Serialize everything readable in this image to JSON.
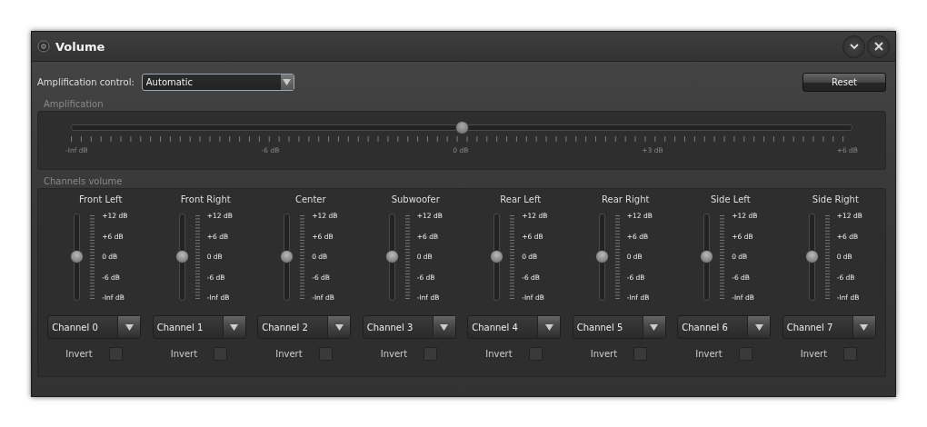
{
  "window": {
    "title": "Volume"
  },
  "amplification_control": {
    "label": "Amplification control:",
    "value": "Automatic"
  },
  "reset_button": "Reset",
  "amplification": {
    "title": "Amplification",
    "level": 0.5,
    "scale": [
      "-Inf dB",
      "-6 dB",
      "0 dB",
      "+3 dB",
      "+6 dB"
    ]
  },
  "channels_volume": {
    "title": "Channels volume",
    "channels": [
      {
        "name": "Front Left",
        "level": 0.5,
        "scale": [
          "+12 dB",
          "+6 dB",
          "0 dB",
          "-6 dB",
          "-Inf dB"
        ],
        "output": "Channel 0",
        "invert_label": "Invert",
        "invert": false
      },
      {
        "name": "Front Right",
        "level": 0.5,
        "scale": [
          "+12 dB",
          "+6 dB",
          "0 dB",
          "-6 dB",
          "-Inf dB"
        ],
        "output": "Channel 1",
        "invert_label": "Invert",
        "invert": false
      },
      {
        "name": "Center",
        "level": 0.5,
        "scale": [
          "+12 dB",
          "+6 dB",
          "0 dB",
          "-6 dB",
          "-Inf dB"
        ],
        "output": "Channel 2",
        "invert_label": "Invert",
        "invert": false
      },
      {
        "name": "Subwoofer",
        "level": 0.5,
        "scale": [
          "+12 dB",
          "+6 dB",
          "0 dB",
          "-6 dB",
          "-Inf dB"
        ],
        "output": "Channel 3",
        "invert_label": "Invert",
        "invert": false
      },
      {
        "name": "Rear Left",
        "level": 0.5,
        "scale": [
          "+12 dB",
          "+6 dB",
          "0 dB",
          "-6 dB",
          "-Inf dB"
        ],
        "output": "Channel 4",
        "invert_label": "Invert",
        "invert": false
      },
      {
        "name": "Rear Right",
        "level": 0.5,
        "scale": [
          "+12 dB",
          "+6 dB",
          "0 dB",
          "-6 dB",
          "-Inf dB"
        ],
        "output": "Channel 5",
        "invert_label": "Invert",
        "invert": false
      },
      {
        "name": "Side Left",
        "level": 0.5,
        "scale": [
          "+12 dB",
          "+6 dB",
          "0 dB",
          "-6 dB",
          "-Inf dB"
        ],
        "output": "Channel 6",
        "invert_label": "Invert",
        "invert": false
      },
      {
        "name": "Side Right",
        "level": 0.5,
        "scale": [
          "+12 dB",
          "+6 dB",
          "0 dB",
          "-6 dB",
          "-Inf dB"
        ],
        "output": "Channel 7",
        "invert_label": "Invert",
        "invert": false
      }
    ]
  }
}
